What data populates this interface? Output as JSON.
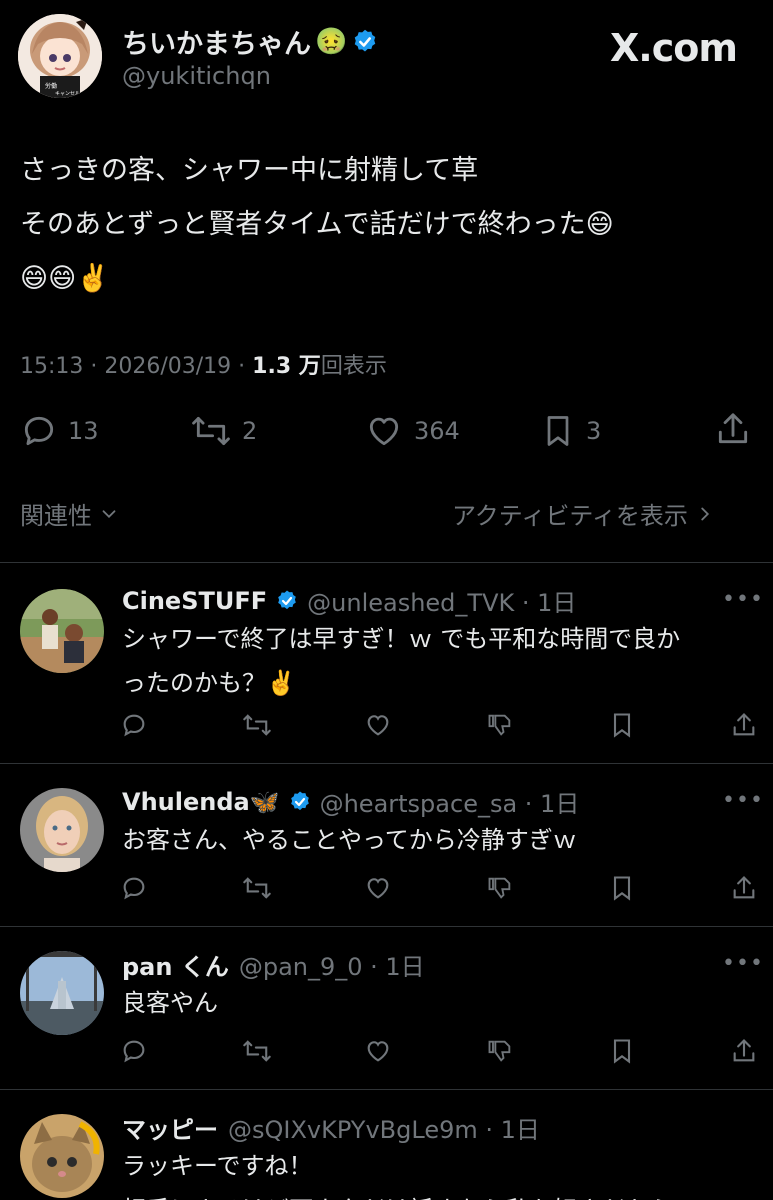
{
  "post": {
    "name": "ちいかまちゃん",
    "name_emoji": "🤢",
    "handle": "@yukitichqn",
    "brand": "X.com",
    "text_line1": "さっきの客、シャワー中に射精して草",
    "text_line2": "そのあとずっと賢者タイムで話だけで終わった😄",
    "text_line3": "😄😄✌️",
    "time": "15:13 · 2026/03/19 · ",
    "views_count": "1.3 万",
    "views_label": "回表示",
    "counts": {
      "replies": "13",
      "reposts": "2",
      "likes": "364",
      "bookmarks": "3"
    }
  },
  "sort": {
    "relevance_label": "関連性",
    "activity_label": "アクティビティを表示"
  },
  "replies": [
    {
      "name": "CineSTUFF",
      "verified": true,
      "handle": "@unleashed_TVK · 1日",
      "line1": "シャワーで終了は早すぎ！ｗ でも平和な時間で良か",
      "line2": "ったのかも？✌️"
    },
    {
      "name": "Vhulenda🦋",
      "verified": true,
      "handle": "@heartspace_sa · 1日",
      "line1": "お客さん、やることやってから冷静すぎｗ",
      "line2": ""
    },
    {
      "name": "pan くん",
      "verified": false,
      "handle": "@pan_9_0 · 1日",
      "line1": "良客やん",
      "line2": ""
    },
    {
      "name": "マッピー",
      "verified": false,
      "handle": "@sQIXvKPYvBgLe9m · 1日",
      "line1": "ラッキーですね！",
      "line2": "相手によるけど下ネタだけ話すなら私も好きだから"
    }
  ],
  "colors": {
    "background": "#000000",
    "text": "#e7e9ea",
    "muted": "#71767b",
    "verified": "#1d9bf0",
    "divider": "#2f3336"
  },
  "icons": [
    "reply-icon",
    "repost-icon",
    "like-icon",
    "bookmark-icon",
    "share-icon",
    "views-icon",
    "more-icon",
    "verified-badge-icon",
    "chevron-down-icon",
    "chevron-right-icon"
  ]
}
